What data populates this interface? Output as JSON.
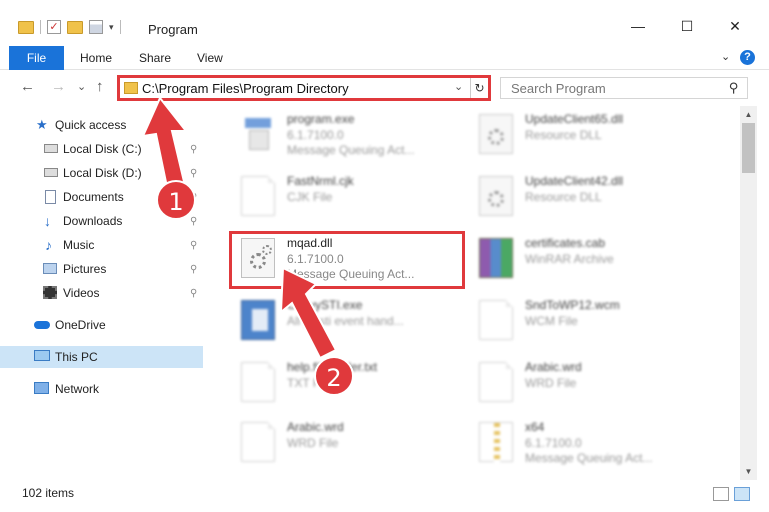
{
  "window": {
    "title": "Program",
    "minimize_glyph": "—",
    "maximize_glyph": "☐",
    "close_glyph": "✕"
  },
  "ribbon": {
    "tabs": [
      "File",
      "Home",
      "Share",
      "View"
    ],
    "expand_glyph": "⌄",
    "help_glyph": "?"
  },
  "nav": {
    "back_glyph": "←",
    "forward_glyph": "→",
    "recent_glyph": "⌄",
    "up_glyph": "↑",
    "address": "C:\\Program Files\\Program Directory",
    "address_dropdown_glyph": "⌄",
    "refresh_glyph": "↻",
    "search_placeholder": "Search Program",
    "search_glyph": "⚲"
  },
  "sidebar": {
    "items": [
      {
        "label": "Quick access",
        "icon": "star-icon"
      },
      {
        "label": "Local Disk (C:)",
        "icon": "drive-icon",
        "pinned": true
      },
      {
        "label": "Local Disk (D:)",
        "icon": "drive-icon",
        "pinned": true
      },
      {
        "label": "Documents",
        "icon": "documents-icon",
        "pinned": true
      },
      {
        "label": "Downloads",
        "icon": "download-icon",
        "pinned": true
      },
      {
        "label": "Music",
        "icon": "music-icon",
        "pinned": true
      },
      {
        "label": "Pictures",
        "icon": "pictures-icon",
        "pinned": true
      },
      {
        "label": "Videos",
        "icon": "videos-icon",
        "pinned": true
      },
      {
        "label": "OneDrive",
        "icon": "cloud-icon"
      },
      {
        "label": "This PC",
        "icon": "computer-icon",
        "selected": true
      },
      {
        "label": "Network",
        "icon": "network-icon"
      }
    ],
    "pin_glyph": "📌"
  },
  "files": [
    {
      "name": "program.exe",
      "line1": "6.1.7100.0",
      "line2": "Message Queuing Act...",
      "icon": "exe-icon"
    },
    {
      "name": "UpdateClient65.dll",
      "line1": "Resource DLL",
      "line2": "",
      "icon": "dll-icon"
    },
    {
      "name": "FastNrml.cjk",
      "line1": "CJK File",
      "line2": "",
      "icon": "document-icon"
    },
    {
      "name": "UpdateClient42.dll",
      "line1": "Resource DLL",
      "line2": "",
      "icon": "dll-icon"
    },
    {
      "name": "mqad.dll",
      "line1": "6.1.7100.0",
      "line2": "Message Queuing Act...",
      "icon": "dll-icon"
    },
    {
      "name": "certificates.cab",
      "line1": "WinRAR Archive",
      "line2": "",
      "icon": "winrar-icon"
    },
    {
      "name": "CopyySTI.exe",
      "line1": "All yy sti event hand...",
      "line2": "",
      "icon": "setup-icon"
    },
    {
      "name": "SndToWP12.wcm",
      "line1": "WCM File",
      "line2": "",
      "icon": "document-icon"
    },
    {
      "name": "help.fileloader.txt",
      "line1": "TXT File",
      "line2": "",
      "icon": "document-icon"
    },
    {
      "name": "Arabic.wrd",
      "line1": "WRD File",
      "line2": "",
      "icon": "document-icon"
    },
    {
      "name": "Arabic.wrd",
      "line1": "WRD File",
      "line2": "",
      "icon": "document-icon"
    },
    {
      "name": "x64",
      "line1": "6.1.7100.0",
      "line2": "Message Queuing Act...",
      "icon": "zip-icon"
    }
  ],
  "status": {
    "item_count": "102 items"
  },
  "annotations": {
    "callout_1": "1",
    "callout_2": "2",
    "color": "#e0393c"
  }
}
